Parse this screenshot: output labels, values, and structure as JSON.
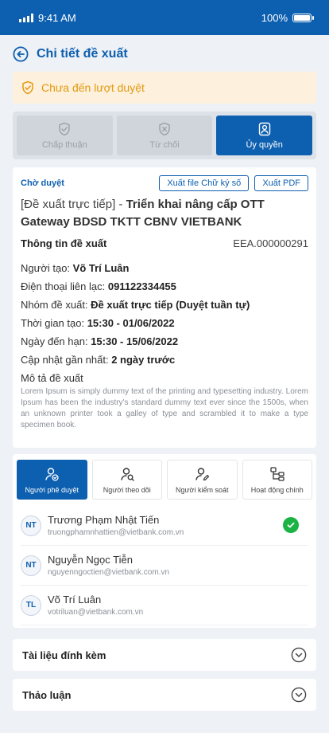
{
  "status_bar": {
    "time": "9:41 AM",
    "battery": "100%"
  },
  "header": {
    "title": "Chi tiết đề xuất"
  },
  "notice": {
    "text": "Chưa đến lượt duyệt",
    "color": "#e39a12"
  },
  "actions": [
    {
      "label": "Chấp thuận",
      "icon": "shield-check-icon",
      "enabled": false
    },
    {
      "label": "Từ chối",
      "icon": "shield-x-icon",
      "enabled": false
    },
    {
      "label": "Ủy quyền",
      "icon": "user-badge-icon",
      "enabled": true
    }
  ],
  "detail": {
    "status": "Chờ duyệt",
    "export_sign_label": "Xuất file Chữ ký số",
    "export_pdf_label": "Xuất PDF",
    "title_prefix": "[Đề xuất trực tiếp] - ",
    "title_name": "Triển khai nâng cấp OTT Gateway BDSD TKTT CBNV VIETBANK",
    "info_label": "Thông tin đề xuất",
    "code": "EEA.000000291",
    "creator_label": "Người tạo: ",
    "creator": "Võ Trí Luân",
    "phone_label": "Điện thoại liên lạc: ",
    "phone": "091122334455",
    "group_label": "Nhóm đề xuất: ",
    "group": "Đề xuất trực tiếp (Duyệt tuần  tự)",
    "created_label": "Thời gian tạo: ",
    "created": "15:30 - 01/06/2022",
    "due_label": "Ngày đến hạn: ",
    "due": "15:30 - 15/06/2022",
    "updated_label": "Cập nhật gần nhất: ",
    "updated": "2 ngày trước",
    "desc_label": "Mô tả đề xuất",
    "desc": "Lorem Ipsum is simply dummy text of the printing and typesetting industry. Lorem Ipsum has been the industry's standard dummy text ever since the 1500s, when an unknown printer took a galley of type and scrambled it to make a type specimen book."
  },
  "people_tabs": [
    {
      "label": "Người phê duyệt",
      "icon": "user-check-icon",
      "active": true
    },
    {
      "label": "Người theo dõi",
      "icon": "user-search-icon",
      "active": false
    },
    {
      "label": "Người kiểm soát",
      "icon": "user-edit-icon",
      "active": false
    },
    {
      "label": "Hoạt động chính",
      "icon": "flow-icon",
      "active": false
    }
  ],
  "people": [
    {
      "initials": "NT",
      "name": "Trương Phạm Nhật Tiến",
      "email": "truongphamnhattien@vietbank.com.vn",
      "approved": true
    },
    {
      "initials": "NT",
      "name": "Nguyễn Ngọc Tiễn",
      "email": "nguyenngoctien@vietbank.com.vn",
      "approved": false
    },
    {
      "initials": "TL",
      "name": "Võ Trí Luân",
      "email": "votriluan@vietbank.com.vn",
      "approved": false
    }
  ],
  "sections": [
    {
      "label": "Tài liệu đính kèm"
    },
    {
      "label": "Thảo luận"
    }
  ],
  "colors": {
    "brand": "#0d5fb0",
    "approved": "#1bb344",
    "warning_bg": "#fdf0dc"
  }
}
